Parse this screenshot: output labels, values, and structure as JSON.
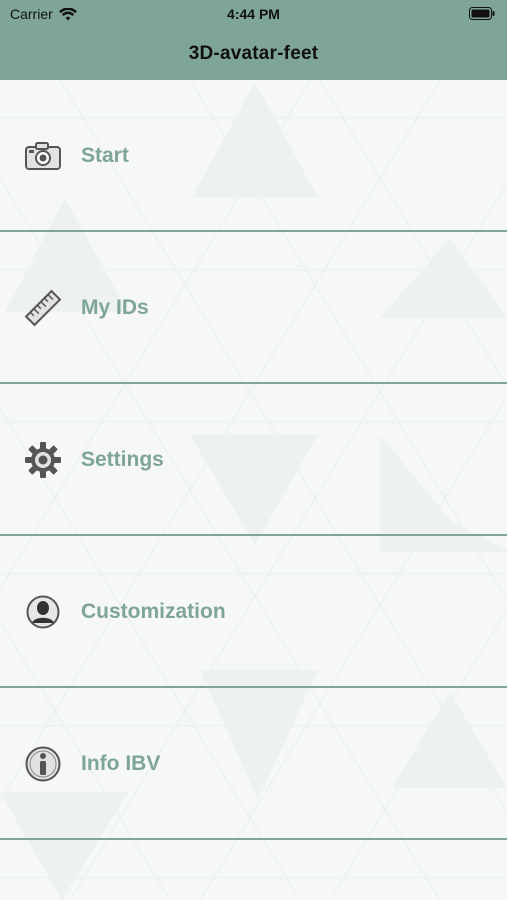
{
  "status_bar": {
    "carrier": "Carrier",
    "time": "4:44 PM"
  },
  "nav": {
    "title": "3D-avatar-feet"
  },
  "menu": {
    "items": [
      {
        "label": "Start",
        "icon": "camera-icon"
      },
      {
        "label": "My IDs",
        "icon": "ruler-icon"
      },
      {
        "label": "Settings",
        "icon": "gear-icon"
      },
      {
        "label": "Customization",
        "icon": "person-icon"
      },
      {
        "label": "Info IBV",
        "icon": "info-icon"
      }
    ]
  },
  "colors": {
    "accent": "#7ea596",
    "background": "#f6f8f8",
    "icon": "#555555"
  }
}
